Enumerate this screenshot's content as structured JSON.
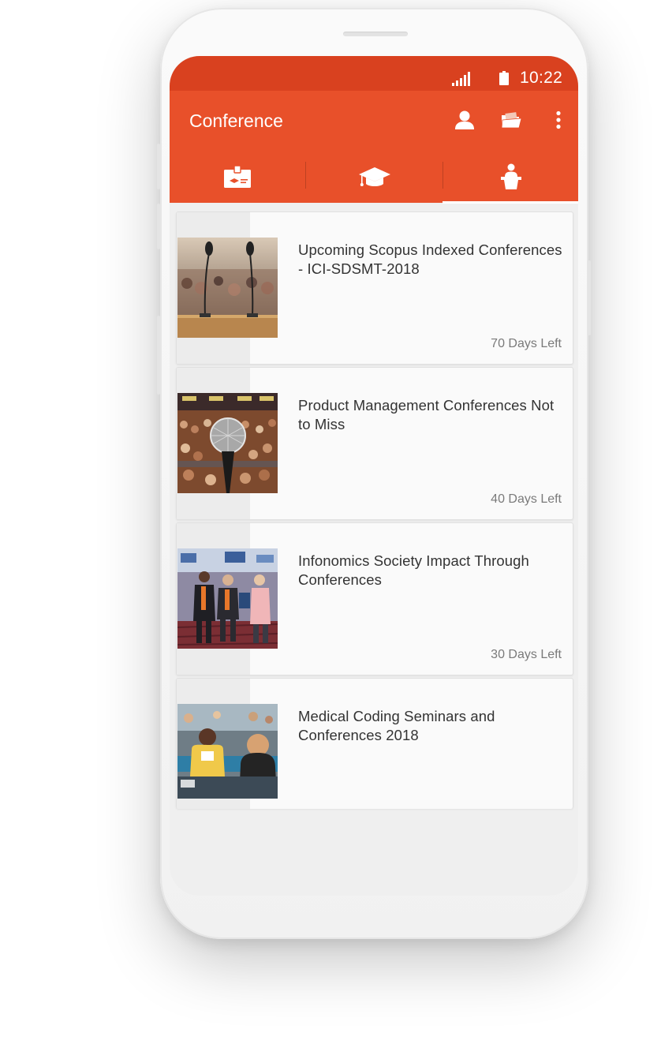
{
  "status_bar": {
    "time": "10:22",
    "signal_icon": "signal-icon",
    "battery_icon": "battery-icon"
  },
  "app_bar": {
    "title": "Conference",
    "actions": [
      "profile-icon",
      "folder-icon",
      "more-vert-icon"
    ]
  },
  "tabs": [
    {
      "icon": "id-badge-icon",
      "selected": false
    },
    {
      "icon": "graduation-cap-icon",
      "selected": false
    },
    {
      "icon": "speaker-podium-icon",
      "selected": true
    }
  ],
  "conferences": [
    {
      "title": "Upcoming Scopus Indexed Conferences - ICI-SDSMT-2018",
      "days_left": "70 Days Left",
      "image": "microphones-podium-photo"
    },
    {
      "title": "Product Management Conferences Not to Miss",
      "days_left": "40 Days Left",
      "image": "microphone-audience-photo"
    },
    {
      "title": "Infonomics Society Impact Through Conferences",
      "days_left": "30 Days Left",
      "image": "attendees-walking-photo"
    },
    {
      "title": "Medical Coding Seminars and Conferences 2018",
      "days_left": "",
      "image": "seminar-table-photo"
    }
  ],
  "colors": {
    "primary": "#e8502a",
    "primary_dark": "#d9411f",
    "card_background": "#fafafa",
    "screen_background": "#efefef"
  }
}
